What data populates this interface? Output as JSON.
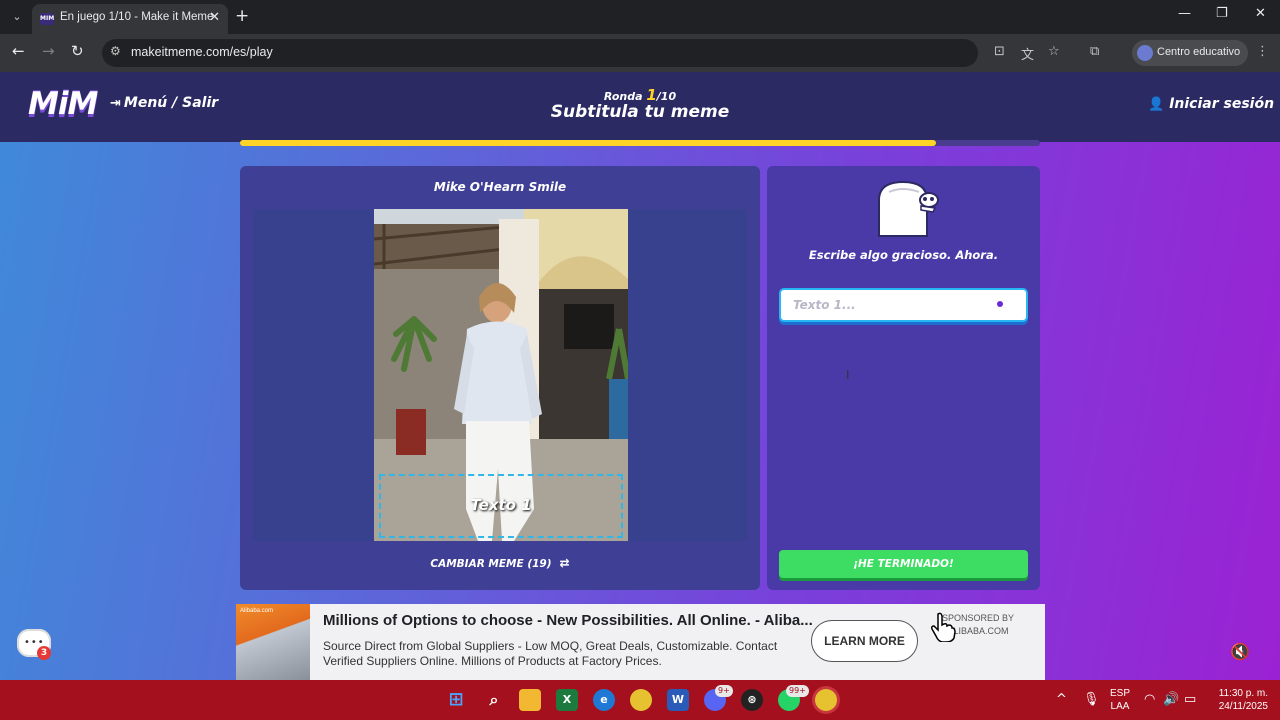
{
  "browser": {
    "tab_title": "En juego 1/10 - Make it Meme",
    "tab_favicon_text": "MIM",
    "url": "makeitmeme.com/es/play",
    "profile_label": "Centro educativo"
  },
  "header": {
    "logo": "MiM",
    "menu_label": "Menú / Salir",
    "round_label": "Ronda",
    "round_current": "1",
    "round_total": "/10",
    "subtitle": "Subtitula tu meme",
    "login_label": "Iniciar sesión",
    "progress_fraction": 0.87
  },
  "meme": {
    "title": "Mike O'Hearn Smile",
    "caption_placeholder": "Texto 1",
    "change_label": "CAMBIAR MEME (19)"
  },
  "composer": {
    "prompt": "Escribe algo gracioso. Ahora.",
    "input_placeholder": "Texto 1...",
    "done_label": "¡HE TERMINADO!"
  },
  "ad": {
    "thumb_label": "Alibaba.com",
    "headline": "Millions of Options to choose - New Possibilities. All Online. - Aliba...",
    "body": "Source Direct from Global Suppliers - Low MOQ, Great Deals, Customizable. Contact Verified Suppliers Online. Millions of Products at Factory Prices.",
    "cta": "LEARN MORE",
    "sponsor_line1": "SPONSORED BY",
    "sponsor_line2": "ALIBABA.COM"
  },
  "chat": {
    "badge": "3"
  },
  "taskbar": {
    "discord_badge": "9+",
    "whatsapp_badge": "99+",
    "lang_line1": "ESP",
    "lang_line2": "LAA",
    "time": "11:30 p. m.",
    "date": "24/11/2025"
  },
  "colors": {
    "header_bg": "#2c2a63",
    "progress": "#ffd426",
    "done_button": "#3ddc63",
    "taskbar": "#a4101d"
  }
}
